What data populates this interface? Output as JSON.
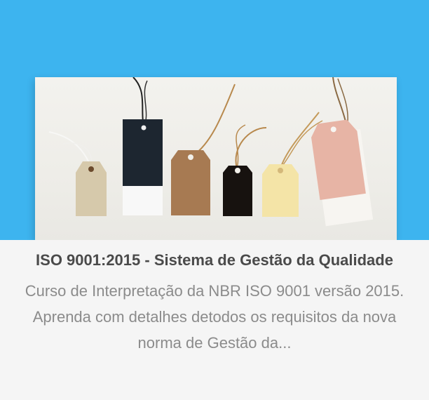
{
  "card": {
    "title": "ISO 9001:2015 - Sistema de Gestão da Qualidade",
    "description": "Curso de Interpretação da NBR ISO 9001 versão 2015. Aprenda com detalhes detodos os requisitos da nova norma de Gestão da...",
    "colors": {
      "header_background": "#3db4ef",
      "title": "#4a4a4a",
      "description": "#8b8b8b"
    }
  }
}
